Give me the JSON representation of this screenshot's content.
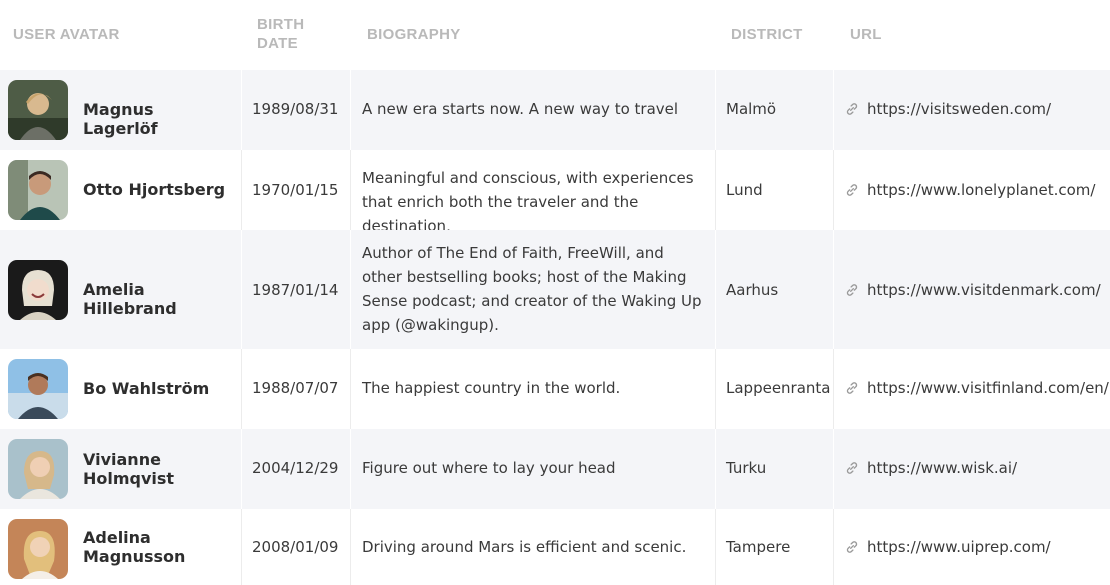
{
  "headers": {
    "avatar": "USER AVATAR",
    "birth_date_line1": "BIRTH",
    "birth_date_line2": "DATE",
    "biography": "BIOGRAPHY",
    "district": "DISTRICT",
    "url": "URL"
  },
  "rows": [
    {
      "name_line1": "Magnus Lagerlöf",
      "name_line2": "",
      "birth_date": "1989/08/31",
      "bio": "A new era starts now. A new way to travel",
      "district": "Malmö",
      "url": "https://visitsweden.com/",
      "avatar_color": "#5b6b52"
    },
    {
      "name_line1": "Otto Hjortsberg",
      "name_line2": "",
      "birth_date": "1970/01/15",
      "bio": "Meaningful and conscious, with experiences that enrich both the traveler and the destination,",
      "district": "Lund",
      "url": "https://www.lonelyplanet.com/",
      "avatar_color": "#8a9a86"
    },
    {
      "name_line1": "Amelia Hillebrand",
      "name_line2": "",
      "birth_date": "1987/01/14",
      "bio": "Author of The End of Faith, FreeWill, and other bestselling books; host of the Making Sense podcast; and creator of the Waking Up app (@wakingup).",
      "district": "Aarhus",
      "url": "https://www.visitdenmark.com/",
      "avatar_color": "#1c1c1c"
    },
    {
      "name_line1": "Bo Wahlström",
      "name_line2": "",
      "birth_date": "1988/07/07",
      "bio": "The happiest country in the world.",
      "district": "Lappeenranta",
      "url": "https://www.visitfinland.com/en/",
      "avatar_color": "#7fb0d6"
    },
    {
      "name_line1": "Vivianne",
      "name_line2": "Holmqvist",
      "birth_date": "2004/12/29",
      "bio": "Figure out where to lay your head",
      "district": "Turku",
      "url": "https://www.wisk.ai/",
      "avatar_color": "#9fb8c2"
    },
    {
      "name_line1": "Adelina",
      "name_line2": "Magnusson",
      "birth_date": "2008/01/09",
      "bio": "Driving around Mars is efficient and scenic.",
      "district": "Tampere",
      "url": "https://www.uiprep.com/",
      "avatar_color": "#c98a5e"
    }
  ]
}
